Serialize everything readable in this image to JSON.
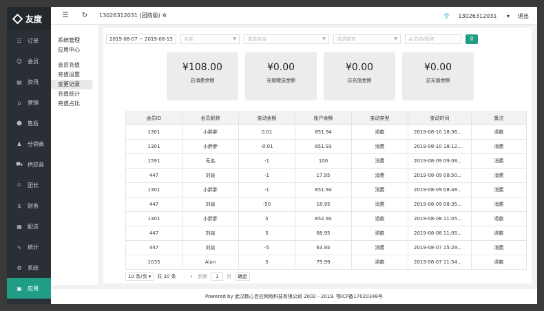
{
  "app": {
    "logo": "友度"
  },
  "sidebar": {
    "items": [
      {
        "label": "订单",
        "icon": "☷"
      },
      {
        "label": "会员",
        "icon": "☺"
      },
      {
        "label": "资讯",
        "icon": "▤"
      },
      {
        "label": "营销",
        "icon": "⌂"
      },
      {
        "label": "售后",
        "icon": "☻"
      },
      {
        "label": "分销商",
        "icon": "♟"
      },
      {
        "label": "供应商",
        "icon": "⛟"
      },
      {
        "label": "团长",
        "icon": "☉"
      },
      {
        "label": "财务",
        "icon": "$"
      },
      {
        "label": "配送",
        "icon": "▦"
      },
      {
        "label": "统计",
        "icon": "∿"
      },
      {
        "label": "系统",
        "icon": "⚙"
      },
      {
        "label": "应用",
        "icon": "▣"
      }
    ]
  },
  "topbar": {
    "title": "13026312031 (团购版)",
    "user": "13026312031",
    "logout": "退出"
  },
  "subnav": {
    "group1": [
      "系统管理",
      "应用中心"
    ],
    "group2": [
      "会员充值",
      "充值设置",
      "变更记录",
      "充值统计",
      "充值占比"
    ]
  },
  "filters": {
    "date_range": "2019-08-07 ~ 2019-08-13",
    "type": "全部",
    "province": "请选择省",
    "city": "请选择市",
    "member_placeholder": "会员ID/昵称"
  },
  "cards": [
    {
      "amount": "¥108.00",
      "label": "总消费余额"
    },
    {
      "amount": "¥0.00",
      "label": "充值赠送金额"
    },
    {
      "amount": "¥0.00",
      "label": "总充值金额"
    },
    {
      "amount": "¥0.00",
      "label": "总充值余额"
    }
  ],
  "table": {
    "headers": [
      "会员ID",
      "会员昵称",
      "变动金额",
      "账户余额",
      "变动类型",
      "变动时间",
      "备注"
    ],
    "rows": [
      [
        "1301",
        "小胖胖",
        "0.01",
        "851.94",
        "退款",
        "2019-08-10 18:36...",
        "退款"
      ],
      [
        "1301",
        "小胖胖",
        "-0.01",
        "851.93",
        "消费",
        "2019-08-10 18:12...",
        "消费"
      ],
      [
        "1591",
        "无名",
        "-1",
        "100",
        "消费",
        "2019-08-09 09:08...",
        "消费"
      ],
      [
        "447",
        "刘燚",
        "-1",
        "17.95",
        "消费",
        "2019-08-09 08:50...",
        "消费"
      ],
      [
        "1301",
        "小胖胖",
        "-1",
        "851.94",
        "消费",
        "2019-08-09 08:48...",
        "消费"
      ],
      [
        "447",
        "刘燚",
        "-50",
        "18.95",
        "消费",
        "2019-08-09 08:35...",
        "消费"
      ],
      [
        "1301",
        "小胖胖",
        "5",
        "852.94",
        "退款",
        "2019-08-08 11:05...",
        "退款"
      ],
      [
        "447",
        "刘燚",
        "5",
        "68.95",
        "退款",
        "2019-08-08 11:05...",
        "退款"
      ],
      [
        "447",
        "刘燚",
        "-5",
        "63.95",
        "消费",
        "2019-08-07 15:29...",
        "消费"
      ],
      [
        "1035",
        "Alan",
        "5",
        "79.99",
        "退款",
        "2019-08-07 11:54...",
        "退款"
      ]
    ]
  },
  "pager": {
    "per_page": "10 条/页",
    "total": "共 20 条",
    "goto": "到第",
    "page": "1",
    "page_unit": "页",
    "confirm": "确定"
  },
  "footer": {
    "text": "Powered by 武汉数心百应网络科技有限公司 2002 - 2019. 鄂ICP备17020348号"
  }
}
